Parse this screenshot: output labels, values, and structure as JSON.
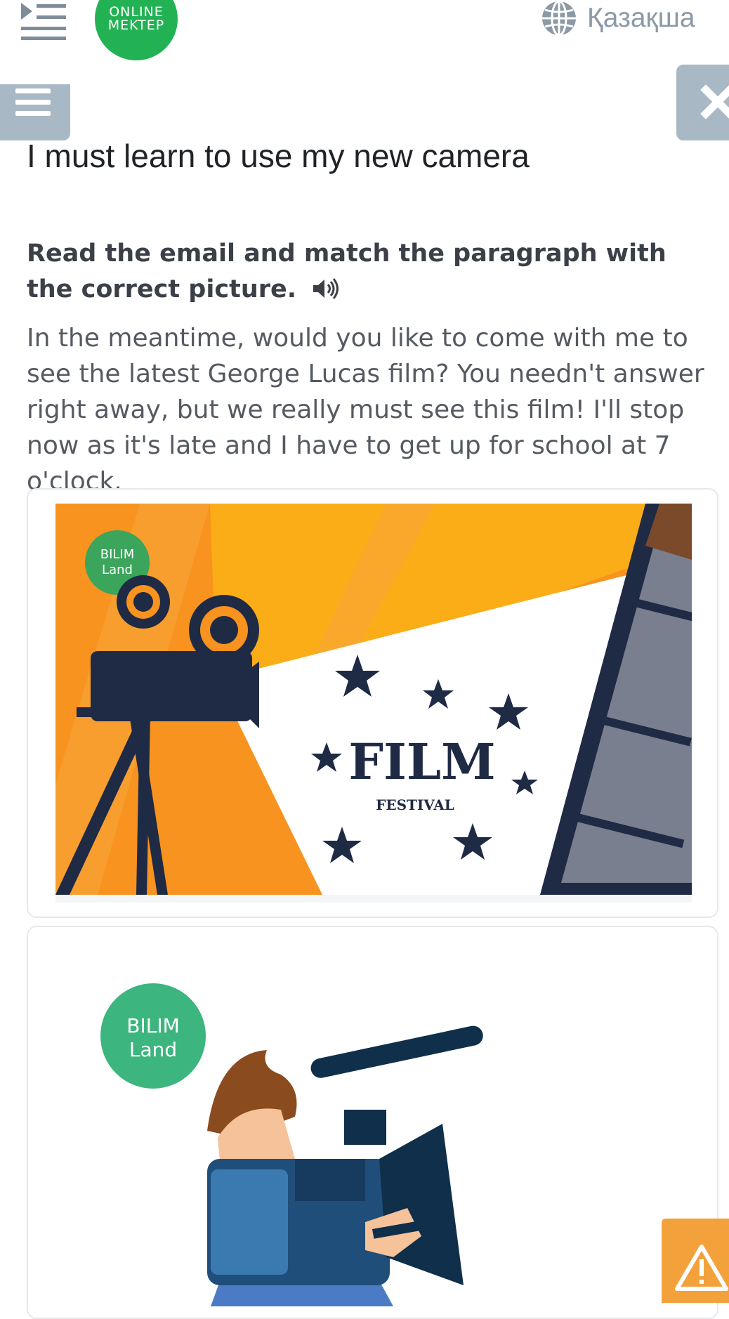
{
  "header": {
    "menu_icon": "menu-collapse-icon",
    "logo": {
      "line1": "ONLINE",
      "line2": "MEKTEP",
      "color": "#22b254"
    },
    "language": {
      "icon": "globe-icon",
      "label": "Қазақша"
    }
  },
  "controls": {
    "sidebar_icon": "hamburger-icon",
    "close_icon": "close-icon",
    "button_color": "#a9b8c5"
  },
  "lesson": {
    "title": "I must learn to use my new camera",
    "instruction": "Read the email and match the paragraph with the correct picture.",
    "audio_icon": "speaker-icon",
    "paragraph": "In the meantime, would you like to come with me to see the latest George Lucas film? You needn't answer right away, but we really must see this film! I'll stop now as it's late and I have to get up for school at 7 o'clock."
  },
  "options": [
    {
      "badge": {
        "line1": "BILIM",
        "line2": "Land"
      },
      "poster_title": "FILM",
      "poster_subtitle": "FESTIVAL",
      "colors": {
        "orange": "#f7931e",
        "navy": "#1f2a44"
      }
    },
    {
      "badge": {
        "line1": "BILIM",
        "line2": "Land"
      },
      "image": "cameraman-illustration"
    }
  ],
  "report_icon": "warning-icon"
}
